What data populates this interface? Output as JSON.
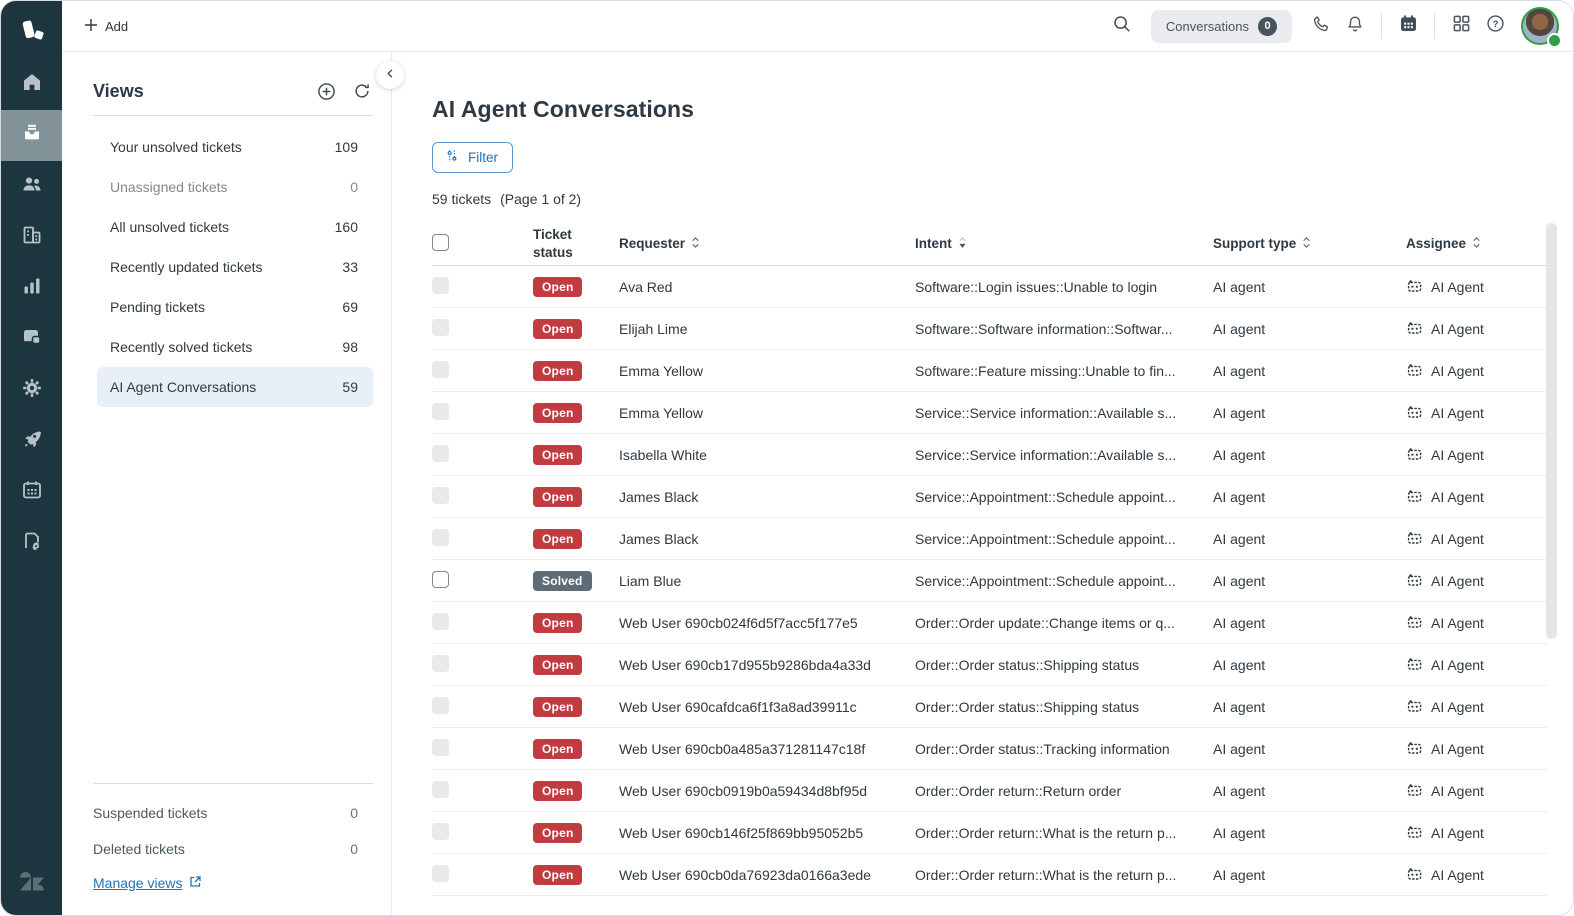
{
  "topbar": {
    "add_label": "Add",
    "conversations_label": "Conversations",
    "conversations_count": "0",
    "icons": [
      "search-icon",
      "phone-icon",
      "notifications-icon",
      "calendar-icon",
      "apps-grid-icon",
      "help-icon",
      "avatar"
    ]
  },
  "sidebar": {
    "icons": [
      "zendesk-logo",
      "home-icon",
      "tickets-icon",
      "customers-icon",
      "organizations-icon",
      "reporting-icon",
      "guide-icon",
      "settings-icon",
      "explore-rocket-icon",
      "calendar-icon",
      "quality-assurance-icon",
      "zendesk-mark"
    ],
    "selected": "tickets"
  },
  "views_panel": {
    "title": "Views",
    "items": [
      {
        "label": "Your unsolved tickets",
        "count": "109"
      },
      {
        "label": "Unassigned tickets",
        "count": "0",
        "muted": true
      },
      {
        "label": "All unsolved tickets",
        "count": "160"
      },
      {
        "label": "Recently updated tickets",
        "count": "33"
      },
      {
        "label": "Pending tickets",
        "count": "69"
      },
      {
        "label": "Recently solved tickets",
        "count": "98"
      },
      {
        "label": "AI Agent Conversations",
        "count": "59",
        "selected": true
      }
    ],
    "footer_items": [
      {
        "label": "Suspended tickets",
        "count": "0"
      },
      {
        "label": "Deleted tickets",
        "count": "0"
      }
    ],
    "manage_views_label": "Manage views"
  },
  "main": {
    "title": "AI Agent Conversations",
    "filter_label": "Filter",
    "ticket_count": "59 tickets",
    "page_info": "(Page 1 of 2)",
    "table": {
      "headers": {
        "ticket_status": "Ticket status",
        "requester": "Requester",
        "intent": "Intent",
        "support_type": "Support type",
        "assignee": "Assignee"
      },
      "sort": {
        "requester": "both",
        "intent": "desc",
        "support_type": "both",
        "assignee": "both"
      },
      "rows": [
        {
          "status": "Open",
          "status_type": "open",
          "checkbox_enabled": false,
          "requester": "Ava Red",
          "intent": "Software::Login issues::Unable to login",
          "support_type": "AI agent",
          "assignee": "AI Agent"
        },
        {
          "status": "Open",
          "status_type": "open",
          "checkbox_enabled": false,
          "requester": "Elijah Lime",
          "intent": "Software::Software information::Softwar...",
          "support_type": "AI agent",
          "assignee": "AI Agent"
        },
        {
          "status": "Open",
          "status_type": "open",
          "checkbox_enabled": false,
          "requester": "Emma Yellow",
          "intent": "Software::Feature missing::Unable to fin...",
          "support_type": "AI agent",
          "assignee": "AI Agent"
        },
        {
          "status": "Open",
          "status_type": "open",
          "checkbox_enabled": false,
          "requester": "Emma Yellow",
          "intent": "Service::Service information::Available s...",
          "support_type": "AI agent",
          "assignee": "AI Agent"
        },
        {
          "status": "Open",
          "status_type": "open",
          "checkbox_enabled": false,
          "requester": "Isabella White",
          "intent": "Service::Service information::Available s...",
          "support_type": "AI agent",
          "assignee": "AI Agent"
        },
        {
          "status": "Open",
          "status_type": "open",
          "checkbox_enabled": false,
          "requester": "James Black",
          "intent": "Service::Appointment::Schedule appoint...",
          "support_type": "AI agent",
          "assignee": "AI Agent"
        },
        {
          "status": "Open",
          "status_type": "open",
          "checkbox_enabled": false,
          "requester": "James Black",
          "intent": "Service::Appointment::Schedule appoint...",
          "support_type": "AI agent",
          "assignee": "AI Agent"
        },
        {
          "status": "Solved",
          "status_type": "solved",
          "checkbox_enabled": true,
          "requester": "Liam Blue",
          "intent": "Service::Appointment::Schedule appoint...",
          "support_type": "AI agent",
          "assignee": "AI Agent"
        },
        {
          "status": "Open",
          "status_type": "open",
          "checkbox_enabled": false,
          "requester": "Web User 690cb024f6d5f7acc5f177e5",
          "intent": "Order::Order update::Change items or q...",
          "support_type": "AI agent",
          "assignee": "AI Agent"
        },
        {
          "status": "Open",
          "status_type": "open",
          "checkbox_enabled": false,
          "requester": "Web User 690cb17d955b9286bda4a33d",
          "intent": "Order::Order status::Shipping status",
          "support_type": "AI agent",
          "assignee": "AI Agent"
        },
        {
          "status": "Open",
          "status_type": "open",
          "checkbox_enabled": false,
          "requester": "Web User 690cafdca6f1f3a8ad39911c",
          "intent": "Order::Order status::Shipping status",
          "support_type": "AI agent",
          "assignee": "AI Agent"
        },
        {
          "status": "Open",
          "status_type": "open",
          "checkbox_enabled": false,
          "requester": "Web User 690cb0a485a371281147c18f",
          "intent": "Order::Order status::Tracking information",
          "support_type": "AI agent",
          "assignee": "AI Agent"
        },
        {
          "status": "Open",
          "status_type": "open",
          "checkbox_enabled": false,
          "requester": "Web User 690cb0919b0a59434d8bf95d",
          "intent": "Order::Order return::Return order",
          "support_type": "AI agent",
          "assignee": "AI Agent"
        },
        {
          "status": "Open",
          "status_type": "open",
          "checkbox_enabled": false,
          "requester": "Web User 690cb146f25f869bb95052b5",
          "intent": "Order::Order return::What is the return p...",
          "support_type": "AI agent",
          "assignee": "AI Agent"
        },
        {
          "status": "Open",
          "status_type": "open",
          "checkbox_enabled": false,
          "requester": "Web User 690cb0da76923da0166a3ede",
          "intent": "Order::Order return::What is the return p...",
          "support_type": "AI agent",
          "assignee": "AI Agent"
        }
      ]
    }
  },
  "colors": {
    "sidebar_bg": "#1c353e",
    "sidebar_selected_bg": "#82939a",
    "view_selected_bg": "#e9eff8",
    "open_badge": "#c13b41",
    "solved_badge": "#5e6c77",
    "link_blue": "#1f73b7",
    "avatar_ring_green": "#2f9e44",
    "conversations_badge_bg": "#49545c"
  }
}
